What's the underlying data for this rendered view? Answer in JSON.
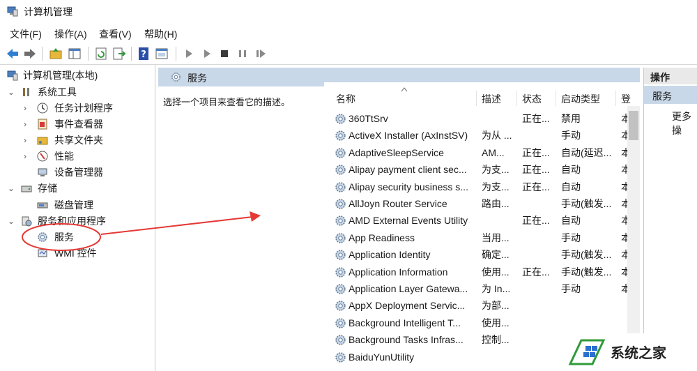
{
  "window": {
    "title": "计算机管理"
  },
  "menu": [
    {
      "label": "文件(F)"
    },
    {
      "label": "操作(A)"
    },
    {
      "label": "查看(V)"
    },
    {
      "label": "帮助(H)"
    }
  ],
  "toolbar": {
    "icons": [
      "back-arrow-icon",
      "forward-arrow-icon",
      "up-folder-icon",
      "show-hide-tree-icon",
      "refresh-icon",
      "export-list-icon",
      "help-icon",
      "properties-icon",
      "start-service-icon",
      "start-icon",
      "stop-service-icon",
      "pause-service-icon",
      "restart-service-icon"
    ]
  },
  "tree": {
    "root": "计算机管理(本地)",
    "system_tools": "系统工具",
    "task_scheduler": "任务计划程序",
    "event_viewer": "事件查看器",
    "shared_folders": "共享文件夹",
    "performance": "性能",
    "device_manager": "设备管理器",
    "storage": "存储",
    "disk_management": "磁盘管理",
    "services_apps": "服务和应用程序",
    "services": "服务",
    "wmi": "WMI 控件"
  },
  "main": {
    "header": "服务",
    "description": "选择一个项目来查看它的描述。",
    "columns": [
      "名称",
      "描述",
      "状态",
      "启动类型",
      "登"
    ],
    "rows": [
      {
        "name": "360TtSrv",
        "desc": "",
        "status": "正在...",
        "startup": "禁用",
        "logon": "本"
      },
      {
        "name": "ActiveX Installer (AxInstSV)",
        "desc": "为从 ...",
        "status": "",
        "startup": "手动",
        "logon": "本"
      },
      {
        "name": "AdaptiveSleepService",
        "desc": "AM...",
        "status": "正在...",
        "startup": "自动(延迟...",
        "logon": "本"
      },
      {
        "name": "Alipay payment client sec...",
        "desc": "为支...",
        "status": "正在...",
        "startup": "自动",
        "logon": "本"
      },
      {
        "name": "Alipay security business s...",
        "desc": "为支...",
        "status": "正在...",
        "startup": "自动",
        "logon": "本"
      },
      {
        "name": "AllJoyn Router Service",
        "desc": "路由...",
        "status": "",
        "startup": "手动(触发...",
        "logon": "本"
      },
      {
        "name": "AMD External Events Utility",
        "desc": "",
        "status": "正在...",
        "startup": "自动",
        "logon": "本"
      },
      {
        "name": "App Readiness",
        "desc": "当用...",
        "status": "",
        "startup": "手动",
        "logon": "本"
      },
      {
        "name": "Application Identity",
        "desc": "确定...",
        "status": "",
        "startup": "手动(触发...",
        "logon": "本"
      },
      {
        "name": "Application Information",
        "desc": "使用...",
        "status": "正在...",
        "startup": "手动(触发...",
        "logon": "本"
      },
      {
        "name": "Application Layer Gatewa...",
        "desc": "为 In...",
        "status": "",
        "startup": "手动",
        "logon": "本"
      },
      {
        "name": "AppX Deployment Servic...",
        "desc": "为部...",
        "status": "",
        "startup": "",
        "logon": ""
      },
      {
        "name": "Background Intelligent T...",
        "desc": "使用...",
        "status": "",
        "startup": "",
        "logon": ""
      },
      {
        "name": "Background Tasks Infras...",
        "desc": "控制...",
        "status": "",
        "startup": "",
        "logon": ""
      },
      {
        "name": "BaiduYunUtility",
        "desc": "",
        "status": "",
        "startup": "",
        "logon": ""
      }
    ]
  },
  "actions": {
    "header": "操作",
    "section": "服务",
    "more": "更多操"
  },
  "watermark": {
    "text": "系统之家"
  },
  "colors": {
    "header_blue": "#c9d8e8",
    "annotation_red": "#e53935"
  }
}
